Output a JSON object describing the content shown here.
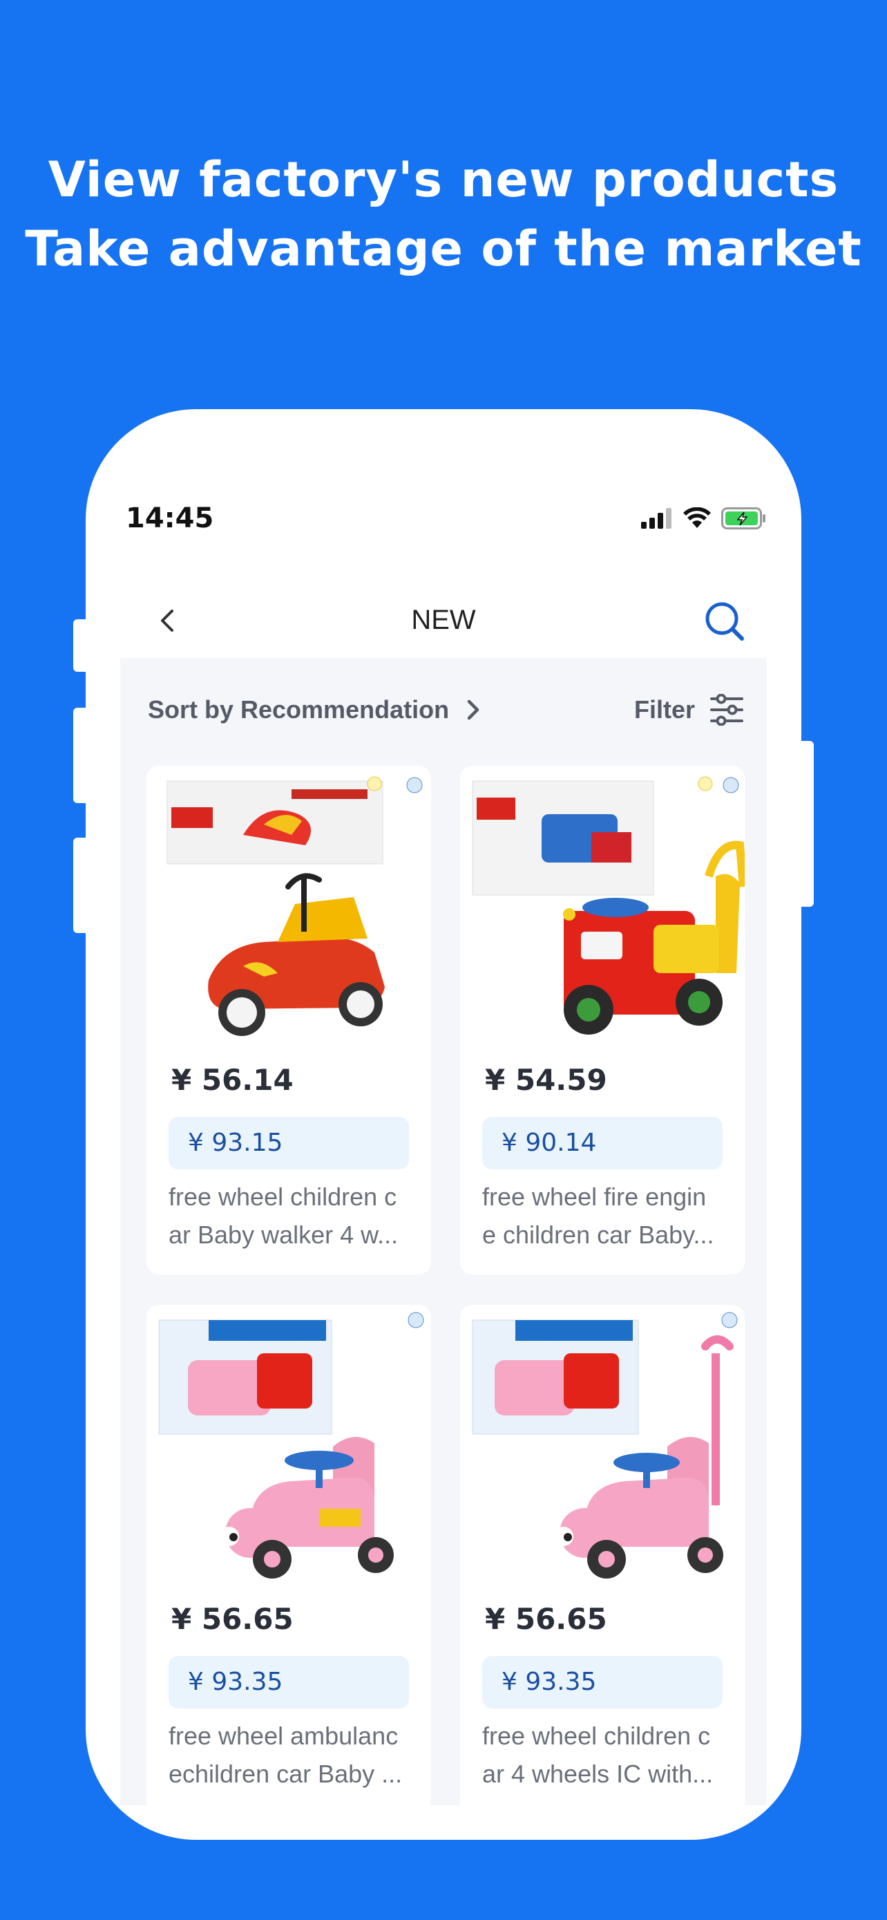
{
  "headline": {
    "line1": "View factory's new products",
    "line2": "Take advantage of the market"
  },
  "status_bar": {
    "time": "14:45",
    "icons": [
      "cellular-signal-icon",
      "wifi-icon",
      "battery-charging-icon"
    ],
    "battery_color": "#3DD35A"
  },
  "nav": {
    "title": "NEW",
    "back_icon": "chevron-left-icon",
    "search_icon": "search-icon"
  },
  "toolbar": {
    "sort_label": "Sort by Recommendation",
    "filter_label": "Filter"
  },
  "colors": {
    "brand": "#1673F2",
    "accent_blue": "#1A5FCC",
    "old_price_bg": "#EAF4FD"
  },
  "products": [
    {
      "price": "¥ 56.14",
      "original_price": "¥ 93.15",
      "title_line1": "free wheel children c",
      "title_line2": "ar Baby walker 4 w...",
      "image": "red-orange ride-on car with box"
    },
    {
      "price": "¥ 54.59",
      "original_price": "¥ 90.14",
      "title_line1": "free wheel fire engin",
      "title_line2": "e children car Baby...",
      "image": "red fire engine ride-on car with box"
    },
    {
      "price": "¥ 56.65",
      "original_price": "¥ 93.35",
      "title_line1": "free wheel ambulanc",
      "title_line2": "echildren car Baby ...",
      "image": "pink ride-on car with box"
    },
    {
      "price": "¥ 56.65",
      "original_price": "¥ 93.35",
      "title_line1": "free wheel children c",
      "title_line2": "ar 4 wheels IC with...",
      "image": "pink ride-on car with push handle and box"
    }
  ]
}
